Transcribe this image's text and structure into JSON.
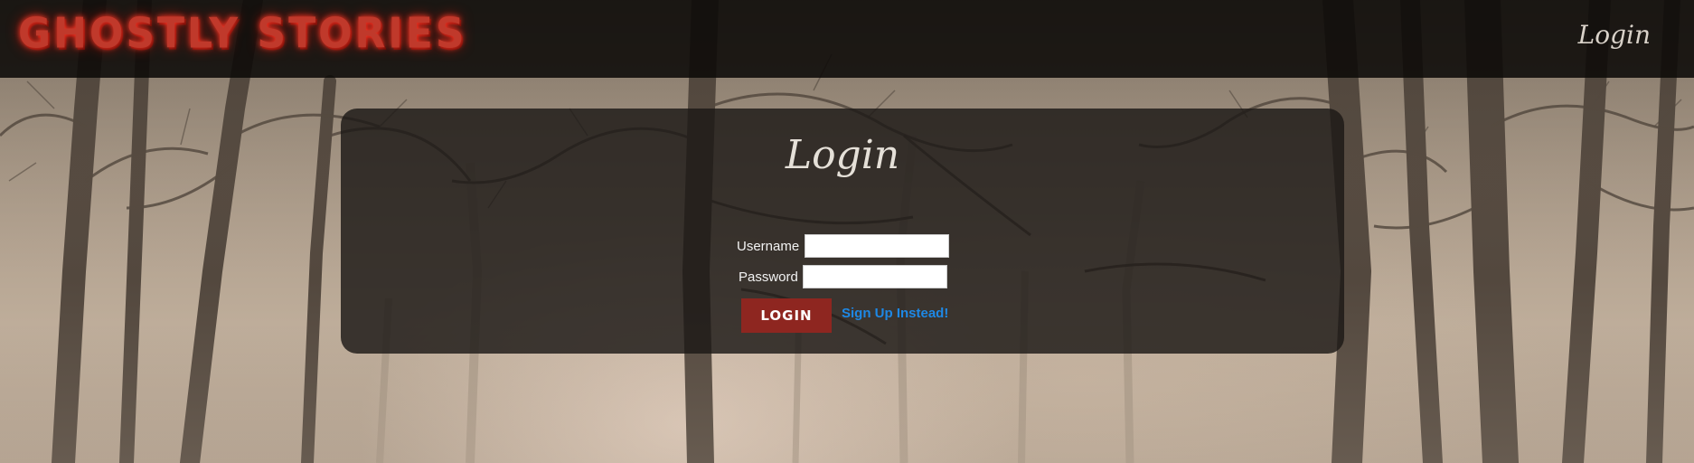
{
  "header": {
    "brand": "GHOSTLY STORIES",
    "nav_login": "Login"
  },
  "login_panel": {
    "title": "Login",
    "username_label": "Username",
    "username_value": "",
    "password_label": "Password",
    "password_value": "",
    "submit_label": "LOGIN",
    "signup_link": "Sign Up Instead!"
  },
  "colors": {
    "brand_red": "#c0392b",
    "button_red": "#8e2620",
    "link_blue": "#1e88e5",
    "panel_bg": "#1c1816"
  },
  "background": {
    "scene": "misty-forest"
  }
}
